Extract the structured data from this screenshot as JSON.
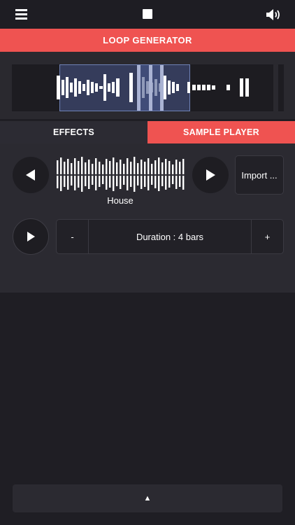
{
  "header": {
    "menu_icon": "hamburger-menu-icon",
    "stop_icon": "stop-icon",
    "volume_icon": "speaker-volume-icon"
  },
  "title": "LOOP GENERATOR",
  "tabs": [
    {
      "label": "EFFECTS",
      "active": false
    },
    {
      "label": "SAMPLE PLAYER",
      "active": true
    }
  ],
  "sample_player": {
    "sample_name": "House",
    "import_label": "Import ...",
    "duration_label": "Duration : 4 bars",
    "decrease_label": "-",
    "increase_label": "+"
  },
  "footer": {
    "expand_label": "▲"
  },
  "colors": {
    "accent": "#ef5351",
    "background": "#1f1e24",
    "panel": "#2b2a31",
    "selection": "#48588c"
  }
}
